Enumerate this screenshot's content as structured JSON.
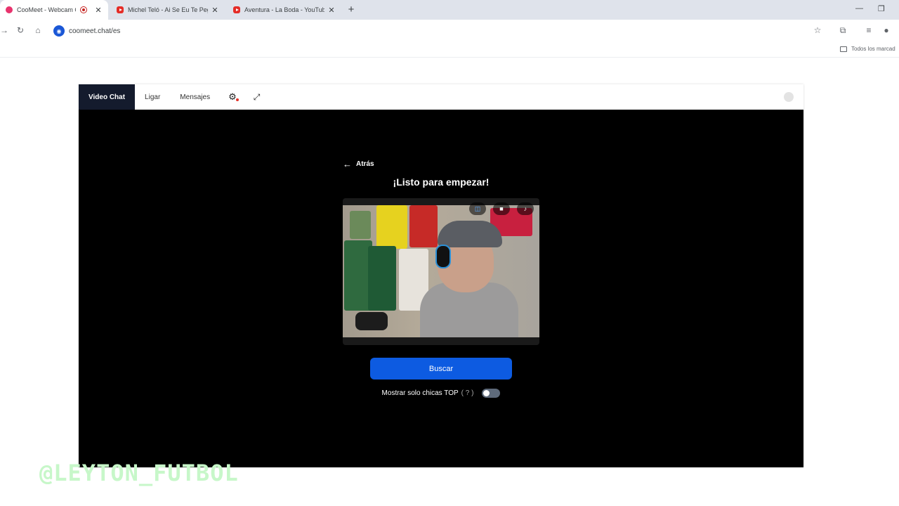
{
  "browser": {
    "tabs": [
      {
        "title": "CooMeet - Webcam Chat c",
        "active": true,
        "favicon": "coomeet-icon"
      },
      {
        "title": "Michel Teló - Ai Se Eu Te Pego",
        "active": false,
        "favicon": "youtube-icon"
      },
      {
        "title": "Aventura - La Boda - YouTube",
        "active": false,
        "favicon": "youtube-icon"
      }
    ],
    "url": "coomeet.chat/es",
    "bookmarks_label": "Todos los marcad"
  },
  "nav": {
    "items": [
      "Video Chat",
      "Ligar",
      "Mensajes"
    ],
    "active_index": 0
  },
  "main": {
    "back_label": "Atrás",
    "heading": "¡Listo para empezar!",
    "search_button": "Buscar",
    "toggle_label": "Mostrar solo chicas TOP",
    "toggle_help": "( ? )",
    "toggle_on": false
  },
  "watermark": "@LEYTON_FUTBOL",
  "colors": {
    "accent": "#0d5be1",
    "nav_active_bg": "#141b2d",
    "stage_bg": "#000000"
  }
}
